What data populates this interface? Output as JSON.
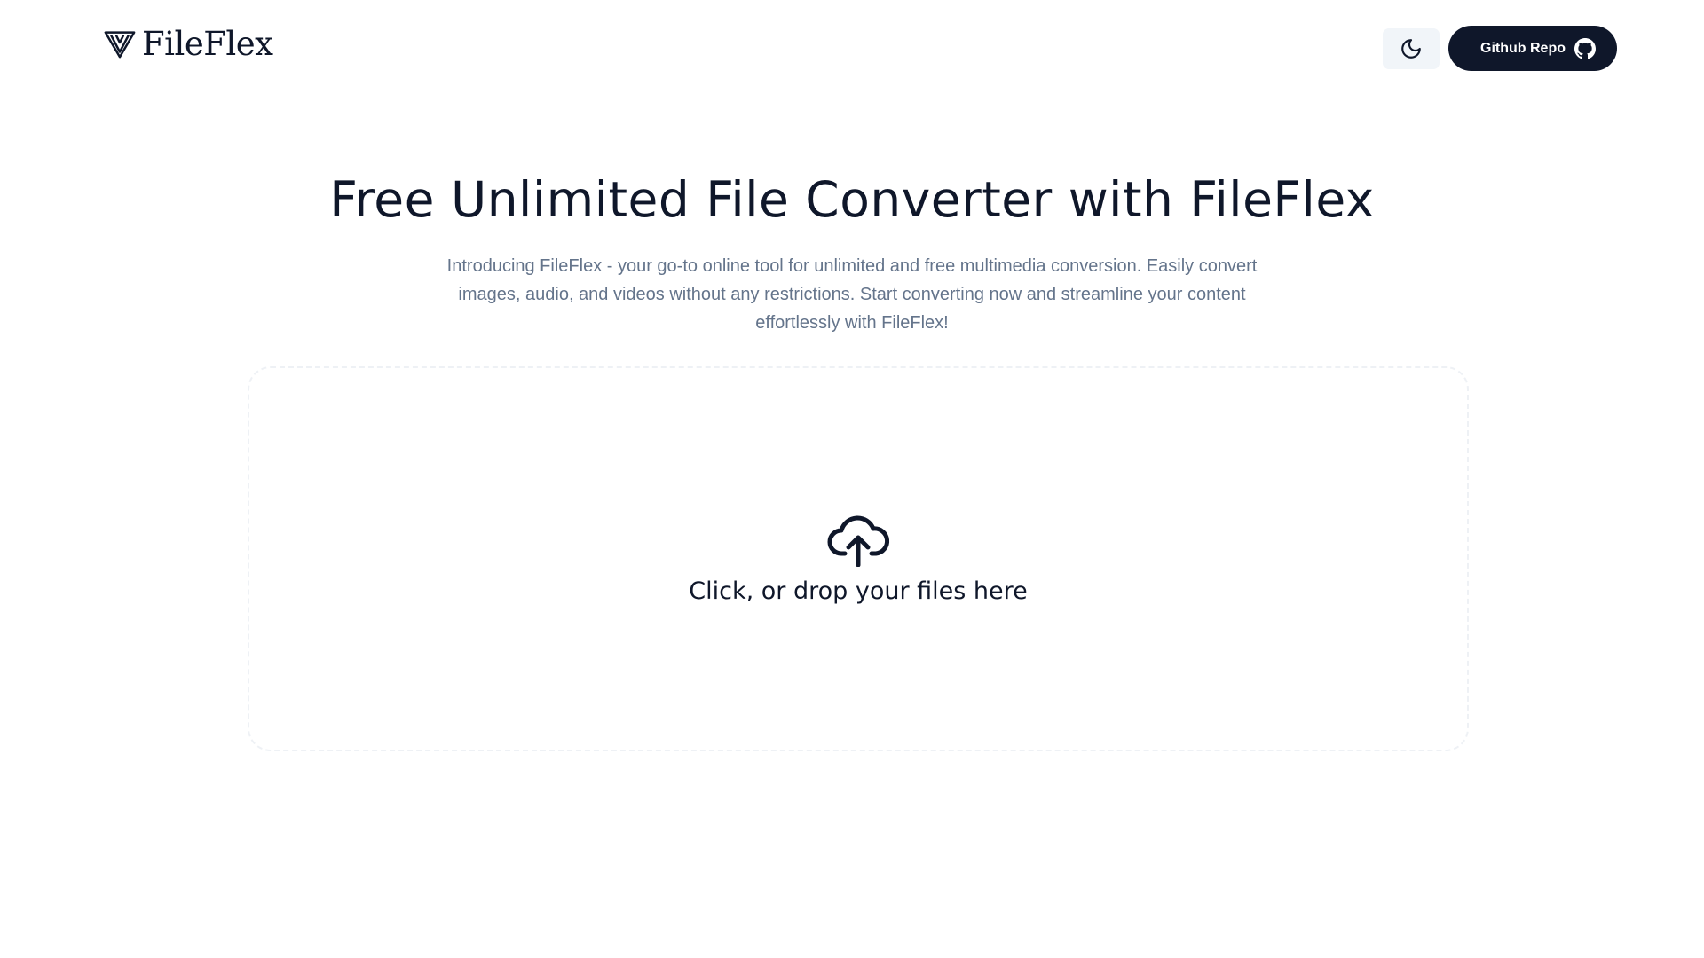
{
  "brand": {
    "name": "FileFlex",
    "logo_icon": "fileflex-logo-icon"
  },
  "nav": {
    "theme_toggle_icon": "moon-icon",
    "github_button_label": "Github Repo",
    "github_icon": "github-icon"
  },
  "hero": {
    "title": "Free Unlimited File Converter with FileFlex",
    "description": "Introducing FileFlex - your go-to online tool for unlimited and free multimedia conversion. Easily convert images, audio, and videos without any restrictions. Start converting now and streamline your content effortlessly with FileFlex!"
  },
  "dropzone": {
    "icon": "cloud-upload-icon",
    "label": "Click, or drop your files here"
  },
  "colors": {
    "primary": "#0f172a",
    "muted_text": "#64748b",
    "toggle_bg": "#f1f5f9",
    "dropzone_border": "#eef1f5",
    "background": "#ffffff"
  }
}
